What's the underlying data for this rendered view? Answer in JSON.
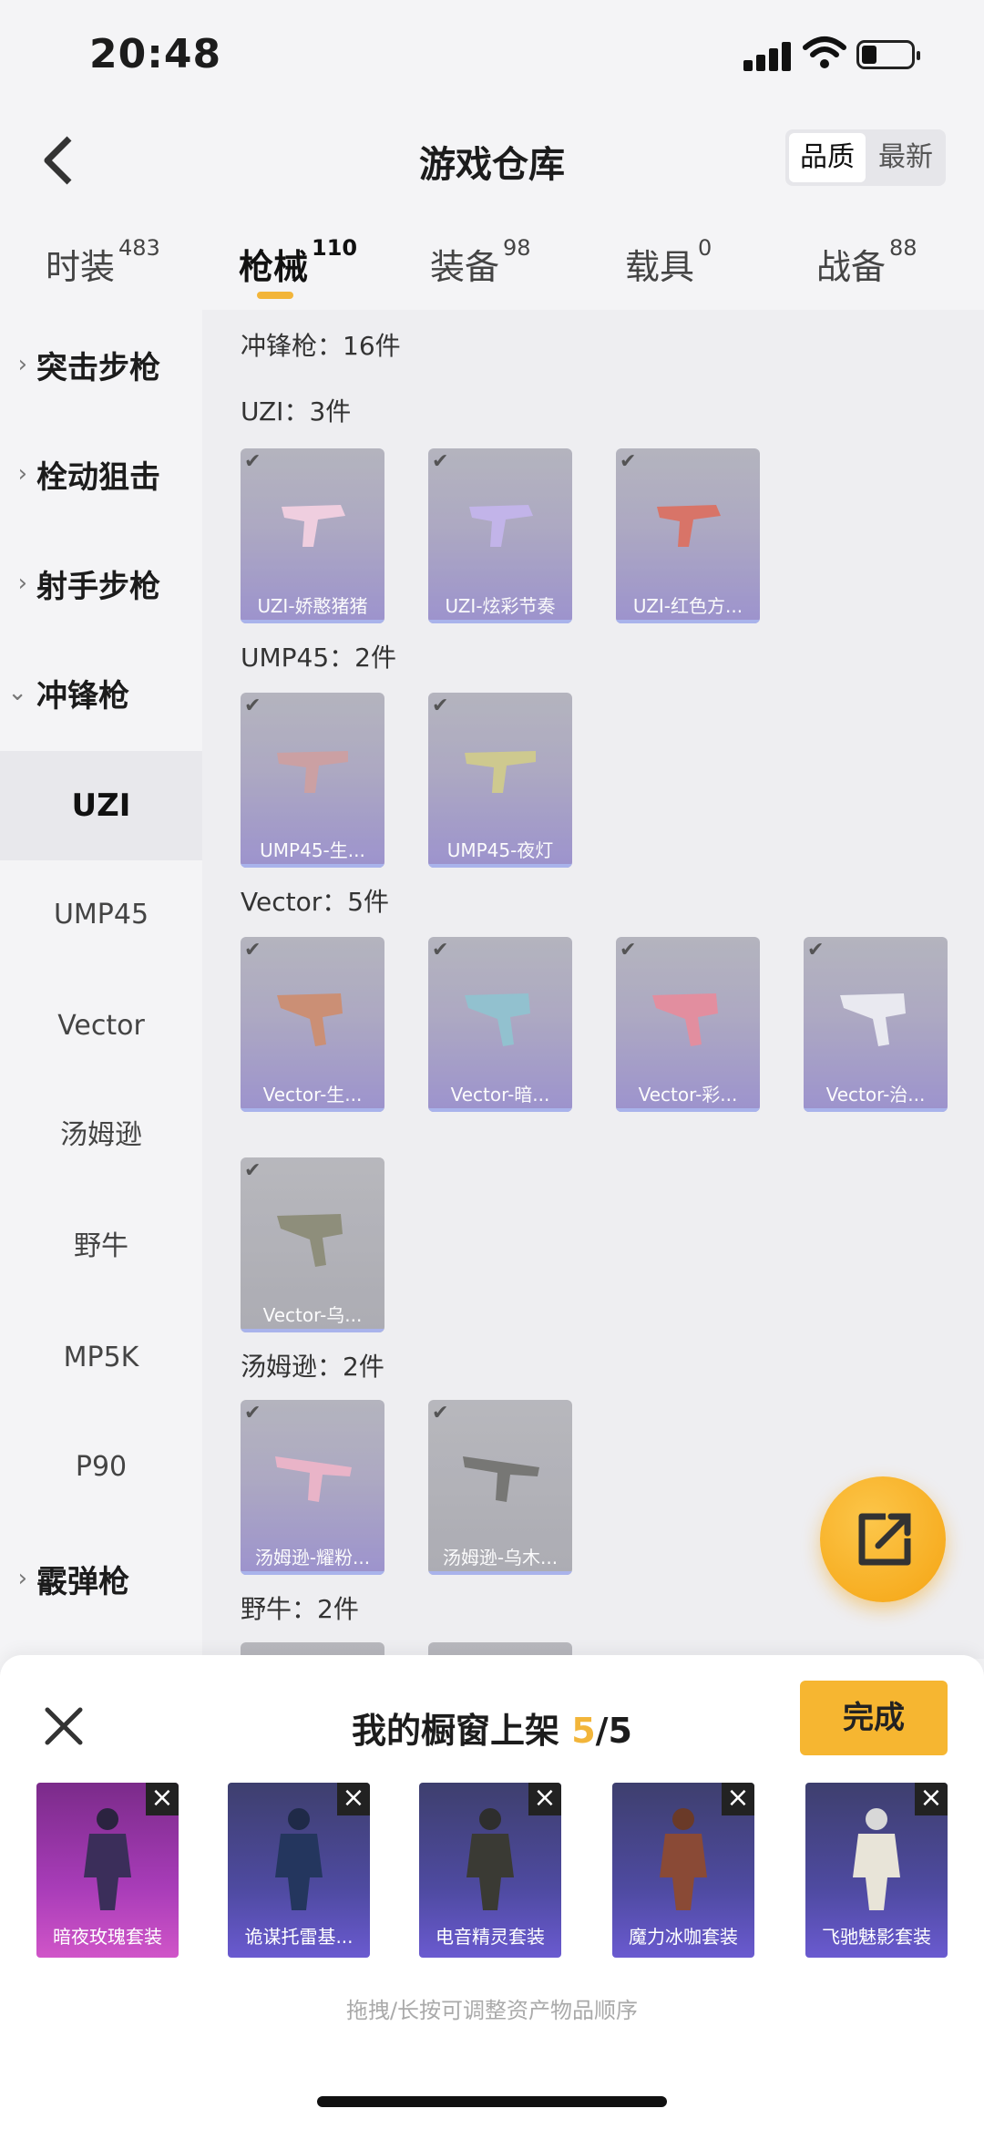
{
  "status": {
    "time": "20:48"
  },
  "header": {
    "title": "游戏仓库",
    "sort_quality": "品质",
    "sort_newest": "最新"
  },
  "tabs": [
    {
      "label": "时装",
      "count": "483"
    },
    {
      "label": "枪械",
      "count": "110"
    },
    {
      "label": "装备",
      "count": "98"
    },
    {
      "label": "载具",
      "count": "0"
    },
    {
      "label": "战备",
      "count": "88"
    }
  ],
  "sidebar": {
    "categories": [
      "突击步枪",
      "栓动狙击",
      "射手步枪",
      "冲锋枪",
      "霰弹枪"
    ],
    "subs": [
      "UZI",
      "UMP45",
      "Vector",
      "汤姆逊",
      "野牛",
      "MP5K",
      "P90"
    ]
  },
  "content": {
    "category_header": "冲锋枪：16件",
    "groups": [
      {
        "label": "UZI：3件",
        "items": [
          "UZI-娇憨猪猪",
          "UZI-炫彩节奏",
          "UZI-红色方..."
        ]
      },
      {
        "label": "UMP45：2件",
        "items": [
          "UMP45-生...",
          "UMP45-夜灯"
        ]
      },
      {
        "label": "Vector：5件",
        "items": [
          "Vector-生...",
          "Vector-暗...",
          "Vector-彩...",
          "Vector-治...",
          "Vector-乌..."
        ]
      },
      {
        "label": "汤姆逊：2件",
        "items": [
          "汤姆逊-耀粉...",
          "汤姆逊-乌木..."
        ]
      },
      {
        "label": "野牛：2件",
        "items": []
      }
    ]
  },
  "sheet": {
    "title_prefix": "我的橱窗上架 ",
    "count_current": "5",
    "count_total": "/5",
    "done": "完成",
    "outfits": [
      "暗夜玫瑰套装",
      "诡谋托雷基...",
      "电音精灵套装",
      "魔力冰咖套装",
      "飞驰魅影套装"
    ],
    "hint": "拖拽/长按可调整资产物品顺序"
  },
  "colors": {
    "accent": "#f2b53a",
    "card_purple": "#8b7fc6"
  },
  "icons": [
    "back-icon",
    "share-icon",
    "close-icon",
    "check-icon",
    "chevron-right-icon",
    "chevron-down-icon"
  ]
}
